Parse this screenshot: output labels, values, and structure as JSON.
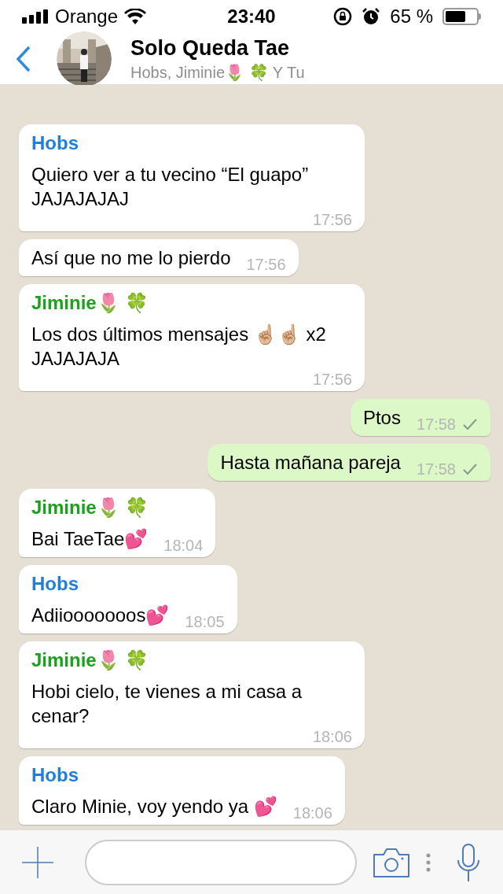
{
  "status_bar": {
    "carrier": "Orange",
    "time": "23:40",
    "battery": "65 %"
  },
  "header": {
    "title": "Solo Queda Tae",
    "members": "Hobs, Jiminie🌷 🍀 Y Tu"
  },
  "messages": [
    {
      "kind": "incoming",
      "sender": {
        "name": "Hobs",
        "color": "#1f7fd9"
      },
      "text": "Quiero ver a tu vecino “El guapo” JAJAJAJAJ",
      "time": "17:56"
    },
    {
      "kind": "incoming",
      "text": "Así que no me lo pierdo",
      "time": "17:56"
    },
    {
      "kind": "incoming",
      "sender": {
        "name": "Jiminie🌷 🍀",
        "color": "#1ba11b"
      },
      "text": "Los dos últimos mensajes ☝🏼☝🏼 x2 JAJAJAJA",
      "time": "17:56"
    },
    {
      "kind": "outgoing",
      "text": "Ptos",
      "time": "17:58",
      "delivered": true
    },
    {
      "kind": "outgoing",
      "text": "Hasta mañana pareja",
      "time": "17:58",
      "delivered": true
    },
    {
      "kind": "incoming",
      "sender": {
        "name": "Jiminie🌷 🍀",
        "color": "#1ba11b"
      },
      "text": "Bai TaeTae💕",
      "time": "18:04"
    },
    {
      "kind": "incoming",
      "sender": {
        "name": "Hobs",
        "color": "#1f7fd9"
      },
      "text": "Adiiooooooos💕",
      "time": "18:05"
    },
    {
      "kind": "incoming",
      "sender": {
        "name": "Jiminie🌷 🍀",
        "color": "#1ba11b"
      },
      "text": "Hobi cielo, te vienes a mi casa a cenar?",
      "time": "18:06"
    },
    {
      "kind": "incoming",
      "sender": {
        "name": "Hobs",
        "color": "#1f7fd9"
      },
      "text": "Claro Minie, voy yendo ya 💕",
      "time": "18:06"
    }
  ]
}
